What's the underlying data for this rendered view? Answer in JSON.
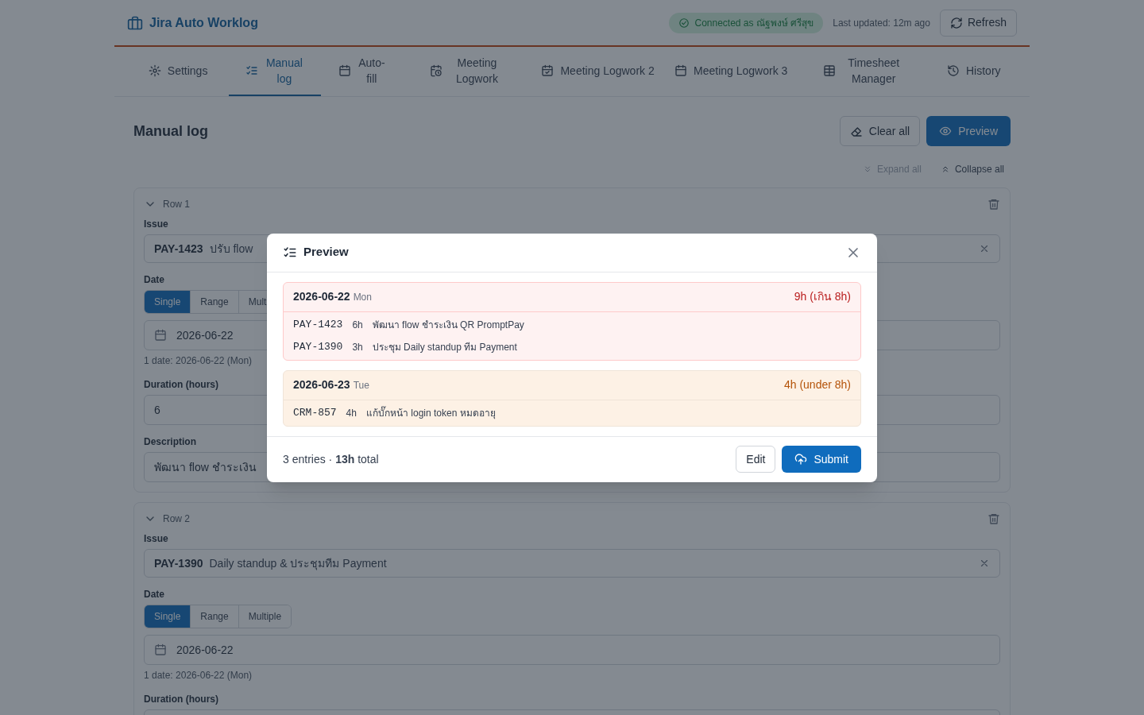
{
  "header": {
    "title": "Jira Auto Worklog",
    "connection": "Connected as ณัฐพงษ์ ศรีสุข",
    "last_updated": "Last updated: 12m ago",
    "refresh_button": "Refresh"
  },
  "tabs": [
    {
      "label": "Settings",
      "selected": false
    },
    {
      "label": "Manual log",
      "selected": true
    },
    {
      "label": "Auto-fill",
      "selected": false
    },
    {
      "label": "Meeting Logwork",
      "selected": false
    },
    {
      "label": "Meeting Logwork 2",
      "selected": false
    },
    {
      "label": "Meeting Logwork 3",
      "selected": false
    },
    {
      "label": "Timesheet Manager",
      "selected": false
    },
    {
      "label": "History",
      "selected": false
    }
  ],
  "page_title": "Manual log",
  "clear_all_button": "Clear all",
  "preview_button": "Preview",
  "expand_all": {
    "label": "Expand all",
    "disabled": true
  },
  "collapse_all": {
    "label": "Collapse all",
    "disabled": false
  },
  "rows": [
    {
      "title": "Row 1",
      "expanded": true,
      "issue_label": "Issue",
      "issue_key": "PAY-1423",
      "issue_summary": "ปรับ flow",
      "date_label": "Date",
      "date_modes": [
        {
          "label": "Single",
          "selected": true
        },
        {
          "label": "Range",
          "selected": false
        },
        {
          "label": "Mult",
          "selected": false
        }
      ],
      "date_value": "2026-06-22",
      "date_note": "1 date: 2026-06-22 (Mon)",
      "duration_label": "Duration (hours)",
      "duration": "6",
      "description_label": "Description",
      "description": "พัฒนา flow ชำระเงิน"
    },
    {
      "title": "Row 2",
      "expanded": true,
      "issue_label": "Issue",
      "issue_key": "PAY-1390",
      "issue_summary": "Daily standup & ประชุมทีม Payment",
      "date_label": "Date",
      "date_modes": [
        {
          "label": "Single",
          "selected": true
        },
        {
          "label": "Range",
          "selected": false
        },
        {
          "label": "Multiple",
          "selected": false
        }
      ],
      "date_value": "2026-06-22",
      "date_note": "1 date: 2026-06-22 (Mon)",
      "duration_label": "Duration (hours)"
    }
  ],
  "modal": {
    "title": "Preview",
    "days": [
      {
        "date": "2026-06-22",
        "weekday": "Mon",
        "total": "9h (เกิน 8h)",
        "over_limit": true,
        "entries": [
          {
            "key": "PAY-1423",
            "hours": "6h",
            "description": "พัฒนา flow ชำระเงิน QR PromptPay"
          },
          {
            "key": "PAY-1390",
            "hours": "3h",
            "description": "ประชุม Daily standup ทีม Payment"
          }
        ]
      },
      {
        "date": "2026-06-23",
        "weekday": "Tue",
        "total": "4h (under 8h)",
        "over_limit": false,
        "entries": [
          {
            "key": "CRM-857",
            "hours": "4h",
            "description": "แก้บั๊กหน้า login token หมดอายุ"
          }
        ]
      }
    ],
    "summary": "3 entries · **13h** total",
    "edit_button": "Edit",
    "submit_button": "Submit"
  }
}
